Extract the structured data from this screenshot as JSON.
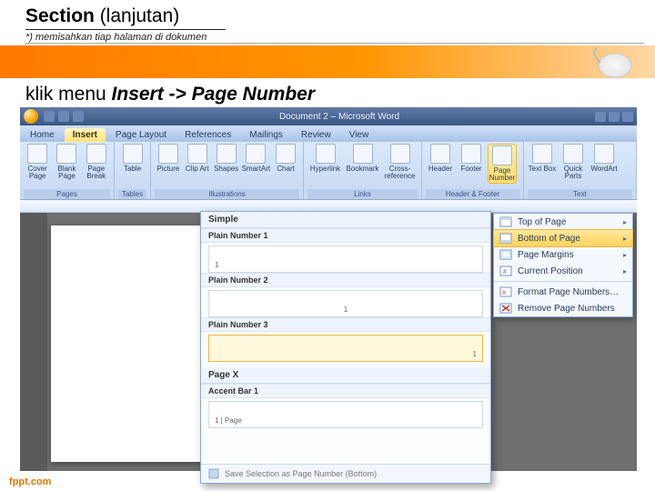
{
  "slide": {
    "title_strong": "Section",
    "title_rest": " (lanjutan)",
    "subtitle": "*) memisahkan tiap halaman di dokumen",
    "instruction_pre": "klik menu ",
    "instruction_bold": "Insert -> Page Number"
  },
  "word": {
    "titlebar": "Document 2 – Microsoft Word",
    "tabs": [
      "Home",
      "Insert",
      "Page Layout",
      "References",
      "Mailings",
      "Review",
      "View"
    ],
    "ribbon": {
      "pages": {
        "label": "Pages",
        "items": [
          "Cover Page",
          "Blank Page",
          "Page Break"
        ]
      },
      "tables": {
        "label": "Tables",
        "items": [
          "Table"
        ]
      },
      "illus": {
        "label": "Illustrations",
        "items": [
          "Picture",
          "Clip Art",
          "Shapes",
          "SmartArt",
          "Chart"
        ]
      },
      "links": {
        "label": "Links",
        "items": [
          "Hyperlink",
          "Bookmark",
          "Cross-reference"
        ]
      },
      "hf": {
        "label": "Header & Footer",
        "items": [
          "Header",
          "Footer",
          "Page Number"
        ]
      },
      "text": {
        "label": "Text",
        "items": [
          "Text Box",
          "Quick Parts",
          "WordArt"
        ]
      }
    },
    "menu": {
      "items": [
        {
          "label": "Top of Page",
          "arrow": true
        },
        {
          "label": "Bottom of Page",
          "arrow": true,
          "highlight": true
        },
        {
          "label": "Page Margins",
          "arrow": true
        },
        {
          "label": "Current Position",
          "arrow": true
        },
        {
          "label": "Format Page Numbers…",
          "arrow": false
        },
        {
          "label": "Remove Page Numbers",
          "arrow": false
        }
      ]
    },
    "gallery": {
      "header": "Simple",
      "entries": [
        {
          "label": "Plain Number 1",
          "pos": "left"
        },
        {
          "label": "Plain Number 2",
          "pos": "center"
        },
        {
          "label": "Plain Number 3",
          "pos": "right",
          "highlight": true
        }
      ],
      "header2": "Page X",
      "entry2": "Accent Bar 1",
      "page_text": "1 | Page",
      "footer": "Save Selection as Page Number (Bottom)"
    }
  },
  "footer_brand": "fppt.com"
}
